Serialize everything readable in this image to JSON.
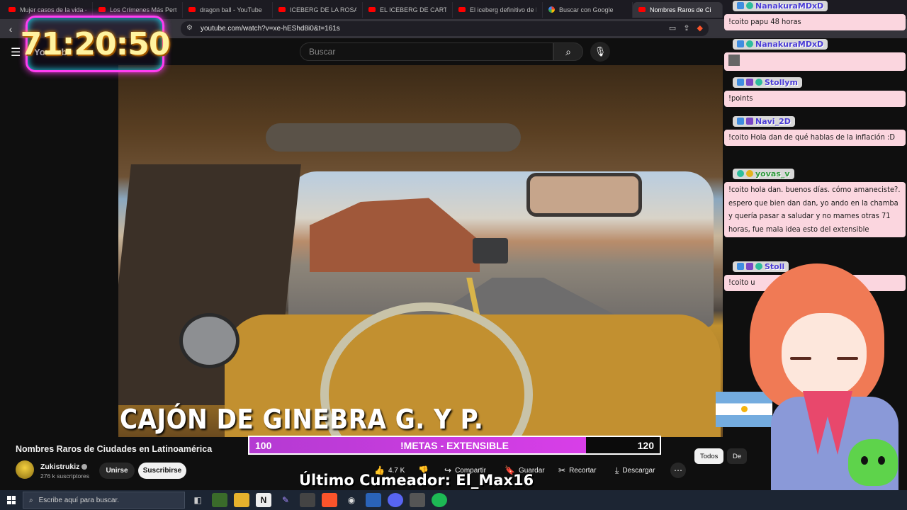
{
  "browser": {
    "tabs": [
      {
        "label": "Mujer casos de la vida - Fa",
        "icon": "youtube-icon"
      },
      {
        "label": "Los Crímenes Más Perturb",
        "icon": "youtube-icon"
      },
      {
        "label": "dragon ball - YouTube",
        "icon": "youtube-icon"
      },
      {
        "label": "ICEBERG DE LA ROSA DE G",
        "icon": "youtube-icon"
      },
      {
        "label": "EL ICEBERG DE CARTOON",
        "icon": "youtube-icon"
      },
      {
        "label": "El iceberg definitivo de Be",
        "icon": "youtube-icon"
      },
      {
        "label": "Buscar con Google",
        "icon": "google-icon"
      },
      {
        "label": "Nombres Raros de Ci",
        "icon": "youtube-icon",
        "active": true
      }
    ],
    "url": "youtube.com/watch?v=xe-hEShd8i0&t=161s"
  },
  "youtube": {
    "logo_text": "YouTube",
    "search_placeholder": "Buscar",
    "video_caption": "CAJÓN DE GINEBRA G. Y P.",
    "video_title": "Nombres Raros de Ciudades en Latinoamérica",
    "channel_name": "Zukistrukiz",
    "subscribers": "276 k suscriptores",
    "join_label": "Unirse",
    "subscribe_label": "Suscribirse",
    "likes": "4.7 K",
    "share_label": "Compartir",
    "save_label": "Guardar",
    "clip_label": "Recortar",
    "download_label": "Descargar",
    "chips": [
      "Todos",
      "De"
    ]
  },
  "overlay": {
    "timer": "71:20:50",
    "goal": {
      "start": "100",
      "label": "!METAS - EXTENSIBLE",
      "end": "120",
      "progress_fraction": 0.82
    },
    "last_cumeador": "Último Cumeador: El_Max16"
  },
  "chat": [
    {
      "user": "NanakuraMDxD",
      "text": "!coito papu 48 horas"
    },
    {
      "user": "NanakuraMDxD",
      "text": ""
    },
    {
      "user": "Stollym",
      "text": "!points"
    },
    {
      "user": "Navi_2D",
      "text": "!coito Hola dan de qué hablas de la inflación :D"
    },
    {
      "user": "yovas_v",
      "text": "!coito hola dan. buenos días. cómo amaneciste?. espero que bien dan dan, yo ando en la chamba y quería pasar a saludar y no mames otras 71 horas, fue mala idea esto del extensible"
    },
    {
      "user": "Stoll",
      "text": "!coito u"
    }
  ],
  "taskbar": {
    "search_placeholder": "Escribe aquí para buscar."
  }
}
